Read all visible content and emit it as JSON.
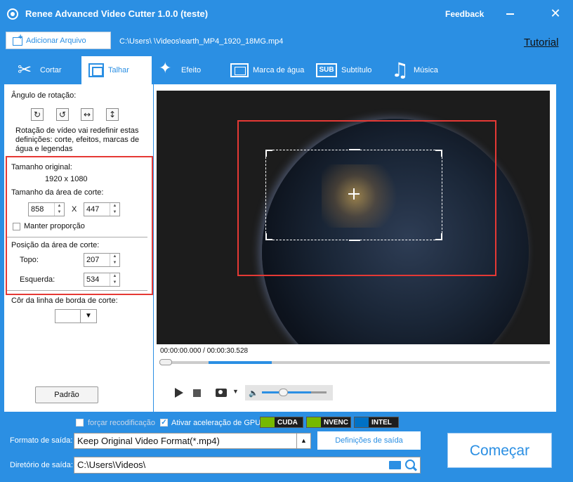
{
  "window": {
    "title": "Renee Advanced Video Cutter 1.0.0 (teste)",
    "feedback": "Feedback",
    "close_glyph": "✕"
  },
  "file_bar": {
    "add_file": "Adicionar Arquivo",
    "file_path": "C:\\Users\\      \\Videos\\earth_MP4_1920_18MG.mp4",
    "tutorial": "Tutorial"
  },
  "tabs": [
    {
      "label": "Cortar",
      "icon": "scissors-icon",
      "active": false
    },
    {
      "label": "Talhar",
      "icon": "crop-icon",
      "active": true
    },
    {
      "label": "Efeito",
      "icon": "magic-wand-icon",
      "active": false
    },
    {
      "label": "Marca de água",
      "icon": "watermark-icon",
      "active": false
    },
    {
      "label": "Subtítulo",
      "icon": "subtitle-icon",
      "icon_text": "SUB",
      "active": false
    },
    {
      "label": "Música",
      "icon": "music-icon",
      "active": false
    }
  ],
  "crop_panel": {
    "rotation_label": "Ângulo de rotação:",
    "rotation_buttons": [
      {
        "name": "rotate-clockwise",
        "glyph": "↻"
      },
      {
        "name": "rotate-counterclockwise",
        "glyph": "↺"
      },
      {
        "name": "flip-horizontal",
        "glyph": "↔"
      },
      {
        "name": "flip-vertical",
        "glyph": "↕"
      }
    ],
    "rotation_note": "Rotação de vídeo vai redefinir estas definições: corte, efeitos, marcas de água e legendas",
    "original_size_label": "Tamanho original:",
    "original_size_value": "1920 x 1080",
    "crop_size_label": "Tamanho da área de corte:",
    "crop_width": "858",
    "size_separator": "X",
    "crop_height": "447",
    "keep_proportion": "Manter proporção",
    "keep_proportion_checked": false,
    "position_label": "Posição da área de corte:",
    "top_label": "Topo:",
    "top_value": "207",
    "left_label": "Esquerda:",
    "left_value": "534",
    "border_color_label": "Côr da linha de borda de corte:",
    "border_color": "#ffffff",
    "default_button": "Padrão"
  },
  "player": {
    "time": "00:00:00.000 / 00:00:30.528",
    "progress": 0,
    "volume_level": 0.76
  },
  "output": {
    "force_reencode": "forçar recodificação",
    "force_reencode_checked": false,
    "gpu_accel": "Ativar aceleração de GPU",
    "gpu_accel_checked": true,
    "gpu_badges": [
      "CUDA",
      "NVENC",
      "INTEL"
    ],
    "format_label": "Formato de saída:",
    "format_value": "Keep Original Video Format(*.mp4)",
    "settings_button": "Definições de saída",
    "dir_label": "Diretório de saída:",
    "dir_value": "C:\\Users\\Videos\\",
    "start_button": "Começar"
  },
  "colors": {
    "accent": "#2b8fe3",
    "highlight_frame": "#e53935"
  }
}
